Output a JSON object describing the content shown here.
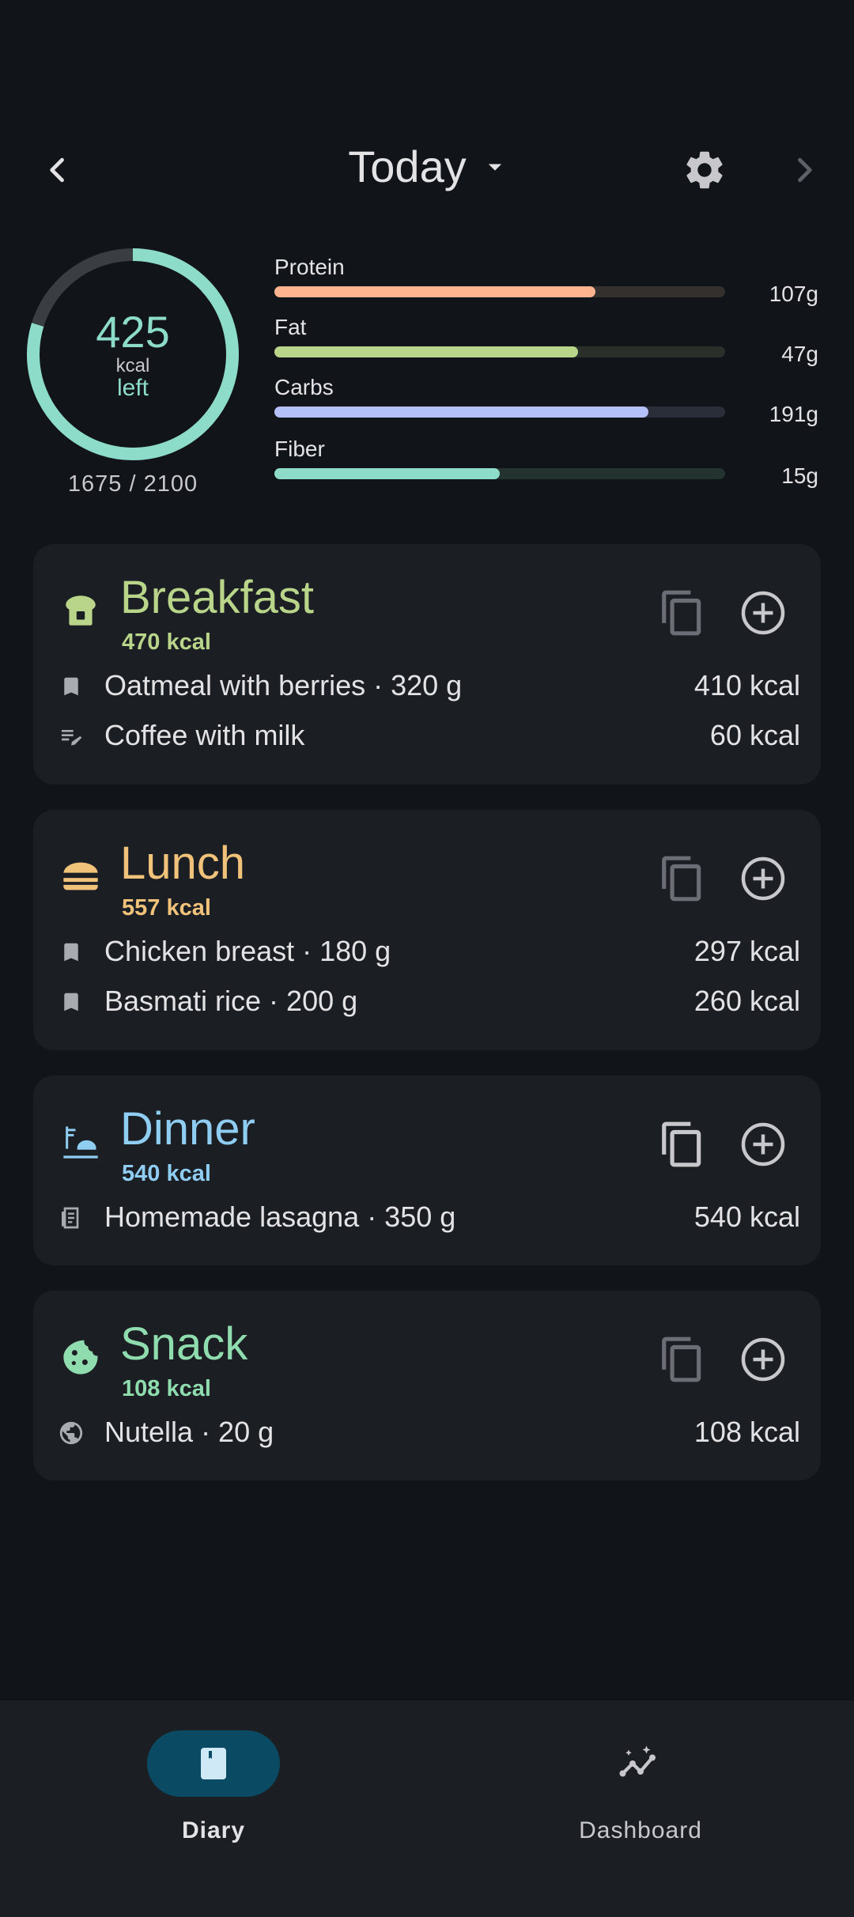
{
  "header": {
    "title": "Today",
    "icons": [
      "chevron-left-icon",
      "dropdown-arrow-icon",
      "gear-icon",
      "chevron-right-icon"
    ]
  },
  "summary": {
    "remaining": "425",
    "unit": "kcal",
    "remaining_label": "left",
    "consumed_total": "1675 / 2100",
    "ring_fraction": 0.7976,
    "macros": [
      {
        "label": "Protein",
        "value": "107g",
        "fraction": 0.713,
        "color": "#ffb38f",
        "track": "#33302e"
      },
      {
        "label": "Fat",
        "value": "47g",
        "fraction": 0.673,
        "color": "#b9d58a",
        "track": "#2a2f2a"
      },
      {
        "label": "Carbs",
        "value": "191g",
        "fraction": 0.83,
        "color": "#b4c0f7",
        "track": "#2a2e38"
      },
      {
        "label": "Fiber",
        "value": "15g",
        "fraction": 0.5,
        "color": "#8ddcc9",
        "track": "#253330"
      }
    ]
  },
  "meals": [
    {
      "name": "Breakfast",
      "kcal": "470 kcal",
      "color": "#b9d58a",
      "icon": "toast-icon",
      "entries": [
        {
          "icon": "bookmark-icon",
          "name": "Oatmeal with berries · 320 g",
          "kcal": "410 kcal"
        },
        {
          "icon": "edit-note-icon",
          "name": "Coffee with milk",
          "kcal": "60 kcal"
        }
      ]
    },
    {
      "name": "Lunch",
      "kcal": "557 kcal",
      "color": "#f0c27a",
      "icon": "burger-icon",
      "entries": [
        {
          "icon": "bookmark-icon",
          "name": "Chicken breast · 180 g",
          "kcal": "297 kcal"
        },
        {
          "icon": "bookmark-icon",
          "name": "Basmati rice · 200 g",
          "kcal": "260 kcal"
        }
      ]
    },
    {
      "name": "Dinner",
      "kcal": "540 kcal",
      "color": "#8fcdf2",
      "icon": "dinner-dish-icon",
      "entries": [
        {
          "icon": "recipe-icon",
          "name": "Homemade lasagna · 350 g",
          "kcal": "540 kcal"
        }
      ]
    },
    {
      "name": "Snack",
      "kcal": "108 kcal",
      "color": "#8fdcae",
      "icon": "cookie-icon",
      "entries": [
        {
          "icon": "globe-icon",
          "name": "Nutella · 20 g",
          "kcal": "108 kcal"
        }
      ]
    }
  ],
  "nav": {
    "items": [
      {
        "label": "Diary",
        "icon": "book-icon",
        "active": true
      },
      {
        "label": "Dashboard",
        "icon": "insights-icon",
        "active": false
      }
    ]
  }
}
